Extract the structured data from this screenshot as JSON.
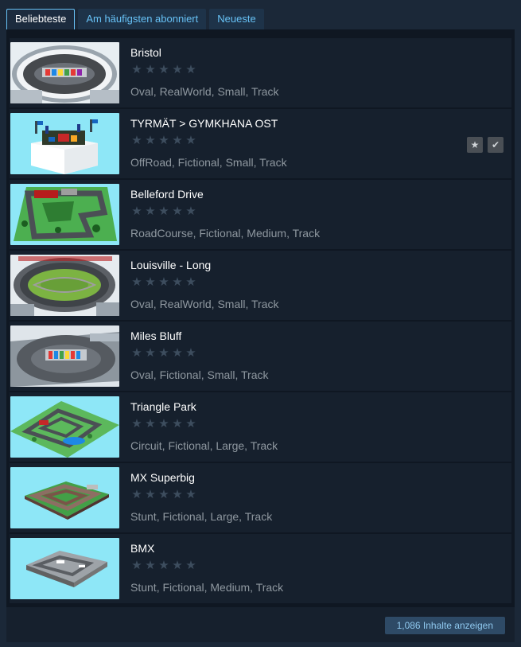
{
  "tabs": [
    {
      "label": "Beliebteste",
      "active": true
    },
    {
      "label": "Am häufigsten abonniert",
      "active": false
    },
    {
      "label": "Neueste",
      "active": false
    }
  ],
  "items": [
    {
      "title": "Bristol",
      "tags": "Oval, RealWorld, Small, Track",
      "thumb": "oval-stadium-white",
      "rating_stars": 0
    },
    {
      "title": "TYRMÄT > GYMKHANA OST",
      "tags": "OffRoad, Fictional, Small, Track",
      "thumb": "cube-island",
      "rating_stars": 0,
      "actions": [
        "favorite-star-icon",
        "subscribed-check-icon"
      ]
    },
    {
      "title": "Belleford Drive",
      "tags": "RoadCourse, Fictional, Medium, Track",
      "thumb": "road-course-green",
      "rating_stars": 0
    },
    {
      "title": "Louisville - Long",
      "tags": "Oval, RealWorld, Small, Track",
      "thumb": "oval-infield-green",
      "rating_stars": 0
    },
    {
      "title": "Miles Bluff",
      "tags": "Oval, Fictional, Small, Track",
      "thumb": "oval-stadium-grey",
      "rating_stars": 0
    },
    {
      "title": "Triangle Park",
      "tags": "Circuit, Fictional, Large, Track",
      "thumb": "park-circuit",
      "rating_stars": 0
    },
    {
      "title": "MX Superbig",
      "tags": "Stunt, Fictional, Large, Track",
      "thumb": "dirt-motocross",
      "rating_stars": 0
    },
    {
      "title": "BMX",
      "tags": "Stunt, Fictional, Medium, Track",
      "thumb": "grey-bmx-pad",
      "rating_stars": 0
    }
  ],
  "footer": {
    "show_all_label": "1,086 Inhalte anzeigen"
  },
  "colors": {
    "background": "#1b2838",
    "panel": "#0f1722",
    "row": "#16202d",
    "accent": "#67c1f5",
    "sky": "#8ee7f7"
  }
}
